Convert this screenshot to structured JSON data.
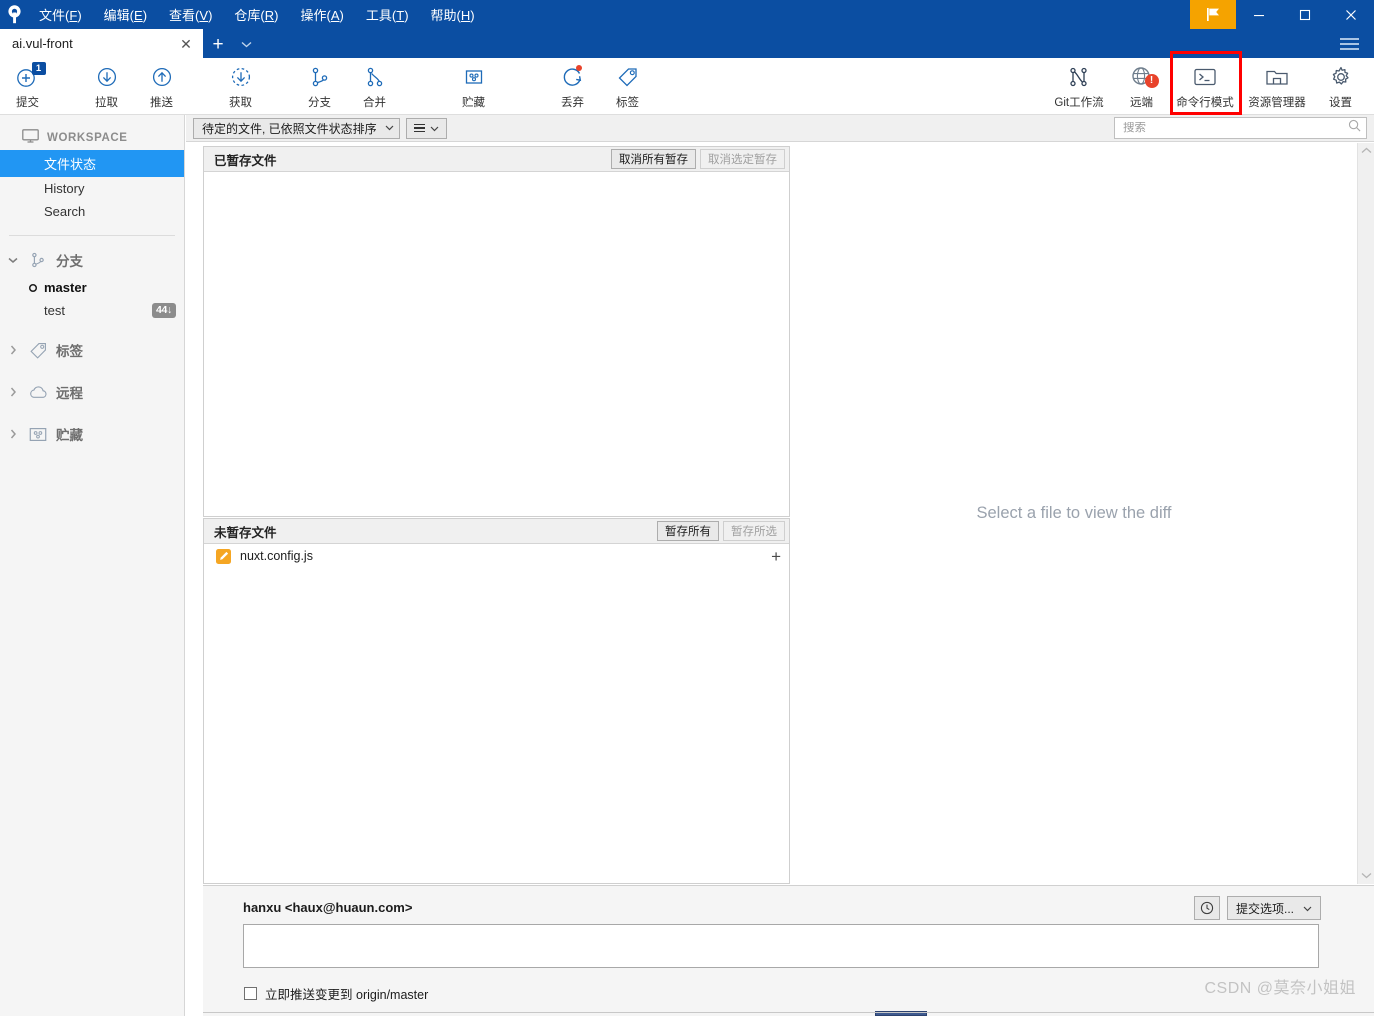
{
  "window": {
    "menus": [
      {
        "label": "文件",
        "accel": "F"
      },
      {
        "label": "编辑",
        "accel": "E"
      },
      {
        "label": "查看",
        "accel": "V"
      },
      {
        "label": "仓库",
        "accel": "R"
      },
      {
        "label": "操作",
        "accel": "A"
      },
      {
        "label": "工具",
        "accel": "T"
      },
      {
        "label": "帮助",
        "accel": "H"
      }
    ],
    "logo_icon": "sourcetree-logo-icon",
    "flag_icon": "flag-icon",
    "minimize_icon": "minimize-icon",
    "maximize_icon": "maximize-icon",
    "close_icon": "close-icon",
    "hamburger_icon": "hamburger-menu-icon"
  },
  "tabs": {
    "active_tab": "ai.vul-front",
    "close_icon": "close-icon",
    "add_icon": "plus-icon",
    "dropdown_icon": "chevron-down-icon"
  },
  "toolbar": {
    "left": [
      {
        "name": "commit",
        "label": "提交",
        "icon": "commit-plus-icon",
        "badge": "1"
      },
      {
        "name": "pull",
        "label": "拉取",
        "icon": "arrow-down-circle-icon"
      },
      {
        "name": "push",
        "label": "推送",
        "icon": "arrow-up-circle-icon"
      },
      {
        "name": "fetch",
        "label": "获取",
        "icon": "fetch-dashed-circle-icon"
      },
      {
        "name": "branch",
        "label": "分支",
        "icon": "branch-icon"
      },
      {
        "name": "merge",
        "label": "合并",
        "icon": "merge-icon"
      },
      {
        "name": "stash",
        "label": "贮藏",
        "icon": "stash-box-icon"
      },
      {
        "name": "discard",
        "label": "丢弃",
        "icon": "discard-refresh-icon"
      },
      {
        "name": "tag",
        "label": "标签",
        "icon": "tag-icon"
      }
    ],
    "right": [
      {
        "name": "git-flow",
        "label": "Git工作流",
        "icon": "git-flow-icon"
      },
      {
        "name": "remote",
        "label": "远端",
        "icon": "globe-icon",
        "alert": "!"
      },
      {
        "name": "terminal",
        "label": "命令行模式",
        "icon": "terminal-icon",
        "highlighted": true
      },
      {
        "name": "explorer",
        "label": "资源管理器",
        "icon": "folder-explorer-icon"
      },
      {
        "name": "settings",
        "label": "设置",
        "icon": "gear-icon"
      }
    ],
    "highlight_color": "#FF0000"
  },
  "sidebar": {
    "workspace": {
      "label": "WORKSPACE",
      "icon": "monitor-icon"
    },
    "workspace_items": [
      {
        "label": "文件状态",
        "active": true
      },
      {
        "label": "History",
        "active": false
      },
      {
        "label": "Search",
        "active": false
      }
    ],
    "groups": [
      {
        "label": "分支",
        "icon": "branch-icon",
        "expanded": true,
        "chevron": "chevron-down-icon"
      },
      {
        "label": "标签",
        "icon": "tag-icon",
        "expanded": false,
        "chevron": "chevron-right-icon"
      },
      {
        "label": "远程",
        "icon": "cloud-icon",
        "expanded": false,
        "chevron": "chevron-right-icon"
      },
      {
        "label": "贮藏",
        "icon": "stash-box-icon",
        "expanded": false,
        "chevron": "chevron-right-icon"
      }
    ],
    "branches": [
      {
        "name": "master",
        "current": true,
        "badge": ""
      },
      {
        "name": "test",
        "current": false,
        "badge": "44↓"
      }
    ]
  },
  "filterbar": {
    "filter_value": "待定的文件, 已依照文件状态排序",
    "filter_caret": "chevron-down-icon",
    "sort_icon": "list-lines-icon",
    "sort_caret": "chevron-down-icon",
    "search_placeholder": "搜索",
    "search_value": "",
    "search_icon": "search-icon"
  },
  "staged_panel": {
    "title": "已暂存文件",
    "buttons": [
      {
        "label": "取消所有暂存",
        "disabled": false
      },
      {
        "label": "取消选定暂存",
        "disabled": true
      }
    ],
    "files": []
  },
  "unstaged_panel": {
    "title": "未暂存文件",
    "buttons": [
      {
        "label": "暂存所有",
        "disabled": false
      },
      {
        "label": "暂存所选",
        "disabled": true
      }
    ],
    "files": [
      {
        "name": "nuxt.config.js",
        "status_icon": "modified-pencil-icon",
        "status_color": "#F5A623",
        "add_icon": "plus-icon"
      }
    ]
  },
  "diff_pane": {
    "empty_message": "Select a file to view the diff",
    "scroll_up_icon": "chevron-up-icon",
    "scroll_down_icon": "chevron-down-icon"
  },
  "commit_area": {
    "author": "hanxu <haux@huaun.com>",
    "message_value": "",
    "message_placeholder": "",
    "history_icon": "clock-icon",
    "options_label": "提交选项...",
    "options_caret": "chevron-down-icon",
    "push_checkbox_checked": false,
    "push_label_prefix": "立即推送变更到",
    "push_label_target": "origin/master"
  },
  "watermark": {
    "text": "CSDN @莫奈小姐姐"
  }
}
